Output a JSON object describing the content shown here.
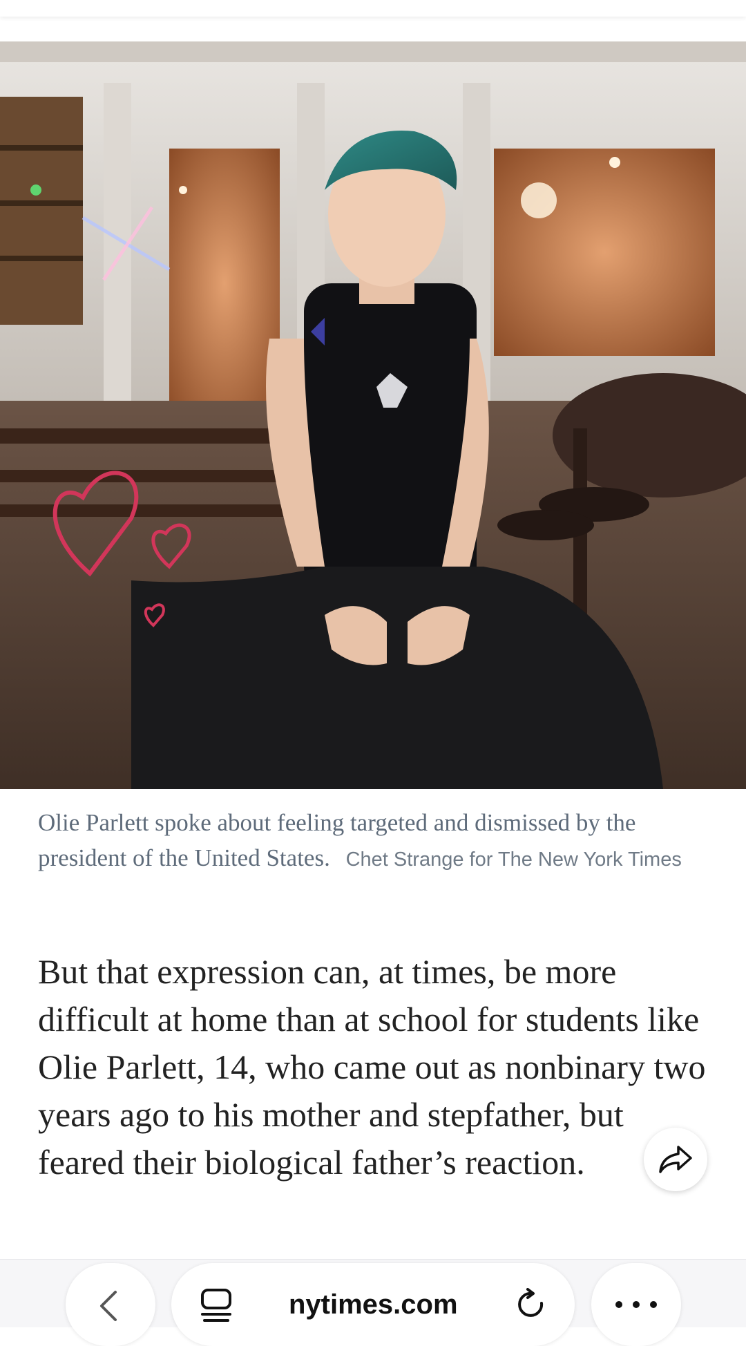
{
  "article": {
    "photo_alt": "Portrait photograph",
    "caption": "Olie Parlett spoke about feeling targeted and dismissed by the president of the United States.",
    "credit": "Chet Strange for The New York Times",
    "paragraph": "But that expression can, at times, be more difficult at home than at school for students like Olie Parlett, 14, who came out as nonbinary two years ago to his mother and stepfather, but feared their biological father’s reaction."
  },
  "browser": {
    "url": "nytimes.com",
    "icons": {
      "back": "chevron-left-icon",
      "tabs": "tabs-icon",
      "reload": "reload-icon",
      "more": "more-icon",
      "share": "share-icon"
    }
  },
  "colors": {
    "caption": "#5e6b7a",
    "body": "#222222",
    "heart": "#d2365a"
  }
}
